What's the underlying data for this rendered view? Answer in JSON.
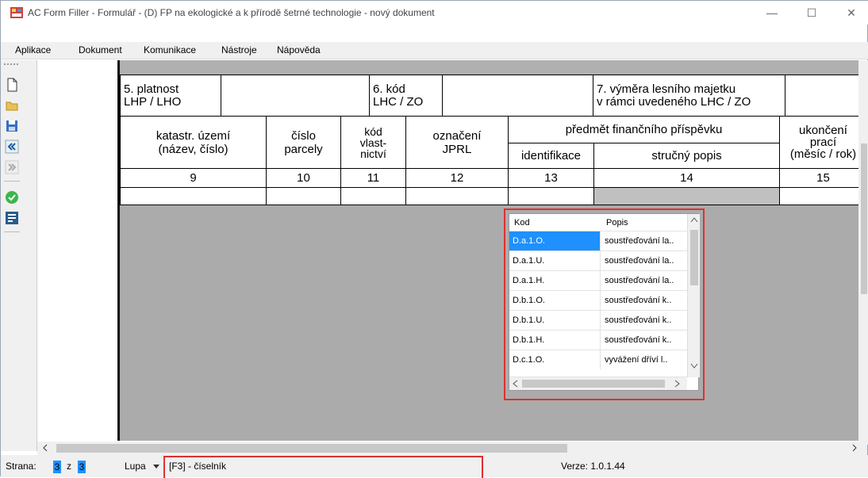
{
  "window": {
    "title": "AC Form Filler - Formulář - (D) FP na ekologické a k přírodě šetrné technologie - nový dokument",
    "controls": [
      "—",
      "☐",
      "✕"
    ]
  },
  "menu": [
    "Aplikace",
    "Dokument",
    "Komunikace",
    "Nástroje",
    "Nápověda"
  ],
  "toolbar": {
    "icons": [
      "new-document-icon",
      "open-folder-icon",
      "save-disk-icon",
      "previous-page-icon",
      "next-page-icon",
      "check-ok-icon",
      "form-icon"
    ]
  },
  "form": {
    "header_row": {
      "field5_label": "5. platnost\nLHP / LHO",
      "field6_label": "6. kód\nLHC / ZO",
      "field7_label": "7. výměra lesního majetku\nv rámci uvedeného LHC / ZO"
    },
    "columns": {
      "c9": "katastr. území\n(název, číslo)",
      "c10": "číslo\nparcely",
      "c11": "kód\nvlast-\nnictví",
      "c12": "označení\nJPRL",
      "group13_14": "předmět finančního příspěvku",
      "c13": "identifikace",
      "c14": "stručný popis",
      "c15": "ukončení\nprací\n(měsíc / rok)"
    },
    "numbers": [
      "9",
      "10",
      "11",
      "12",
      "13",
      "14",
      "15"
    ]
  },
  "lookup": {
    "headers": {
      "kod": "Kod",
      "popis": "Popis"
    },
    "rows": [
      {
        "kod": "D.a.1.O.",
        "popis": "soustřeďování la.."
      },
      {
        "kod": "D.a.1.U.",
        "popis": "soustřeďování la.."
      },
      {
        "kod": "D.a.1.H.",
        "popis": "soustřeďování la.."
      },
      {
        "kod": "D.b.1.O.",
        "popis": "soustřeďování k.."
      },
      {
        "kod": "D.b.1.U.",
        "popis": "soustřeďování k.."
      },
      {
        "kod": "D.b.1.H.",
        "popis": "soustřeďování k.."
      },
      {
        "kod": "D.c.1.O.",
        "popis": "vyvážení dříví l.."
      }
    ]
  },
  "status": {
    "page_label": "Strana:",
    "page_current": "3",
    "page_sep": "z",
    "page_total": "3",
    "zoom_label": "Lupa",
    "hint": "[F3] - číselník",
    "version": "Verze: 1.0.1.44"
  },
  "colors": {
    "selection": "#1e90ff",
    "highlight": "#e03030",
    "doc_bg": "#ababab"
  }
}
